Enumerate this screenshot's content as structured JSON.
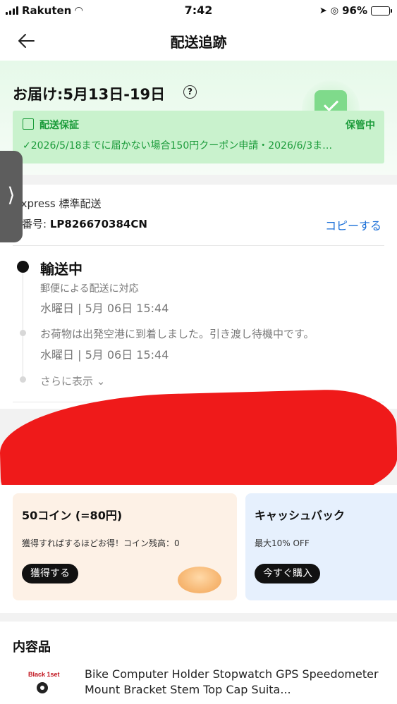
{
  "status_bar": {
    "carrier": "Rakuten",
    "time": "7:42",
    "battery": "96%",
    "battery_level": 0.96
  },
  "header": {
    "title": "配送追跡"
  },
  "delivery": {
    "title": "お届け:5月13日-19日",
    "help_symbol": "?",
    "guarantee_label": "配送保証",
    "guarantee_status": "保管中",
    "guarantee_desc": "✓2026/5/18までに届かない場合150円クーポン申請・2026/6/3ま…"
  },
  "shipping": {
    "carrier": "iExpress 標準配送",
    "tracking_label": "跡番号: ",
    "tracking_number": "LP826670384CN",
    "copy_label": "コピーする"
  },
  "timeline": {
    "status": "輸送中",
    "status_desc": "郵便による配送に対応",
    "status_time": "水曜日 | 5月 06日 15:44",
    "event_desc": "お荷物は出発空港に到着しました。引き渡し待機中です。",
    "event_time": "水曜日 | 5月 06日 15:44",
    "more_label": "さらに表示 ⌄"
  },
  "promos": {
    "coin": {
      "title": "50コイン (=80円)",
      "subtitle": "獲得すればするほどお得！コイン残高：0",
      "button": "獲得する"
    },
    "cashback": {
      "title": "キャッシュバック",
      "subtitle": "最大10% OFF",
      "button": "今すぐ購入"
    }
  },
  "contents": {
    "title": "内容品",
    "items": [
      {
        "thumb_label": "Black 1set",
        "name": "Bike Computer Holder Stopwatch GPS Speedometer Mount Bracket Stem Top Cap Suita..."
      }
    ]
  },
  "colors": {
    "accent_green": "#1b9b3a",
    "link_blue": "#1a6fd8",
    "redaction": "#ef1a1a"
  }
}
